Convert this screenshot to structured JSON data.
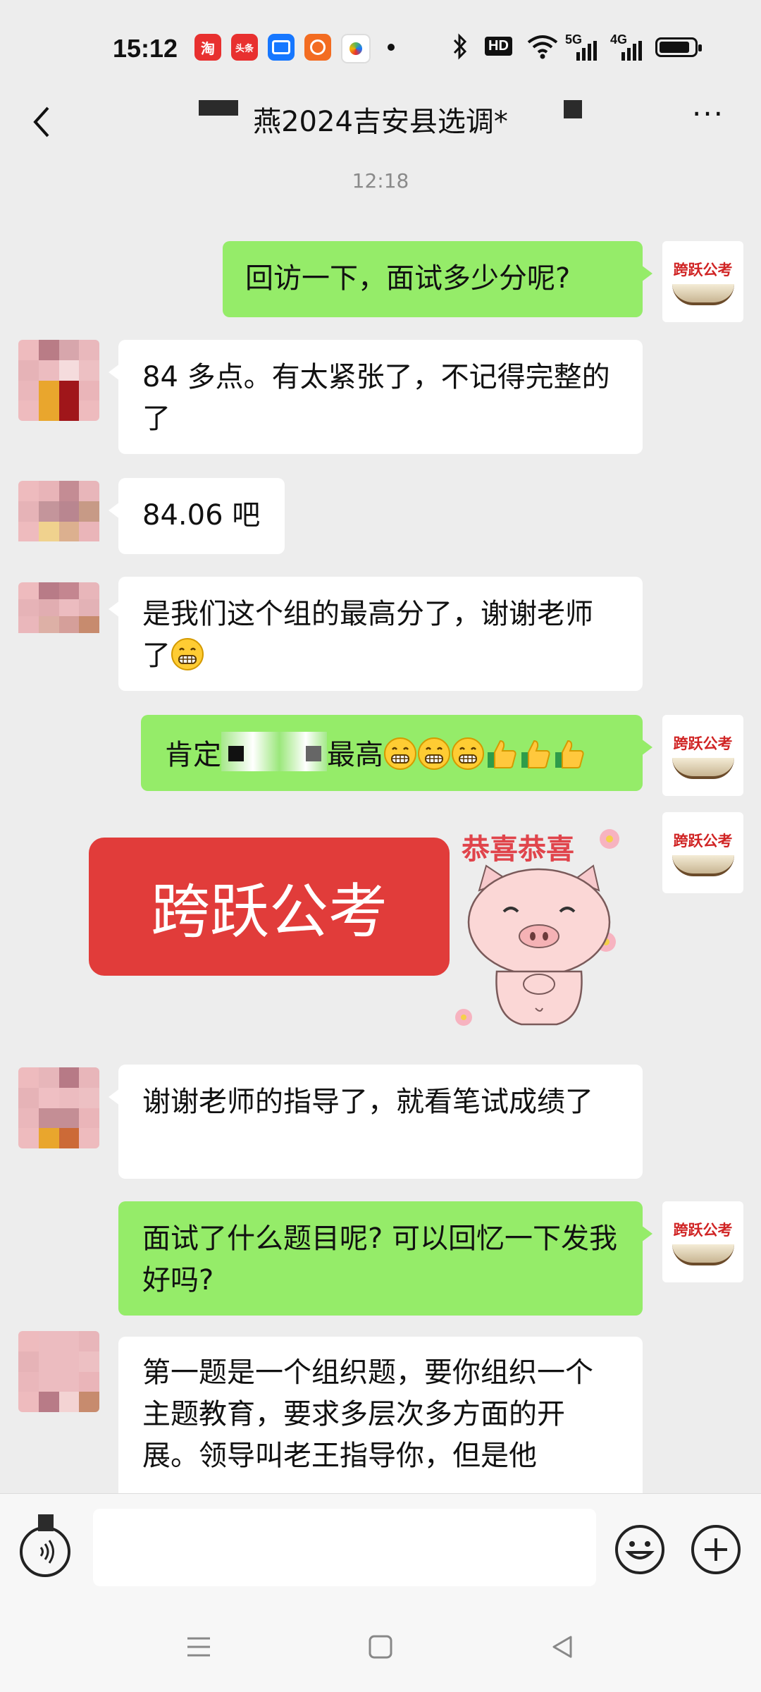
{
  "status_bar": {
    "time": "15:12",
    "app_icons": [
      {
        "name": "taobao-icon",
        "glyph": "淘",
        "color": "#e8302f"
      },
      {
        "name": "toutiao-icon",
        "glyph": "头条",
        "color": "#e8302f"
      },
      {
        "name": "blue-app-icon",
        "glyph": "",
        "color": "#1677ff"
      },
      {
        "name": "orange-app-icon",
        "glyph": "",
        "color": "#f36c21"
      },
      {
        "name": "colorful-app-icon",
        "glyph": "",
        "color": "#56b65a"
      }
    ],
    "hd_label": "HD",
    "net1": "5G",
    "net2": "4G"
  },
  "header": {
    "title": "燕2024吉安县选调*",
    "back_icon": "chevron-left-icon",
    "more_icon": "more-icon"
  },
  "messages": {
    "timestamp": "12:18",
    "m1": "回访一下，面试多少分呢?",
    "m2": "84 多点。有太紧张了，不记得完整的了",
    "m3": "84.06 吧",
    "m4": "是我们这个组的最高分了，谢谢老师了",
    "m5_prefix": "肯定",
    "m5_suffix": "最高",
    "sticker_banner": "跨跃公考",
    "sticker_caption": "恭喜恭喜",
    "m7": "谢谢老师的指导了，就看笔试成绩了",
    "m8": "面试了什么题目呢? 可以回忆一下发我好吗?",
    "m9": "第一题是一个组织题，要你组织一个主题教育，要求多层次多方面的开展。领导叫老王指导你，但是他"
  },
  "brand_avatar_text": "跨跃公考",
  "input": {
    "placeholder": ""
  },
  "colors": {
    "my_bubble": "#95ec69",
    "other_bubble": "#ffffff",
    "background": "#ededed"
  }
}
